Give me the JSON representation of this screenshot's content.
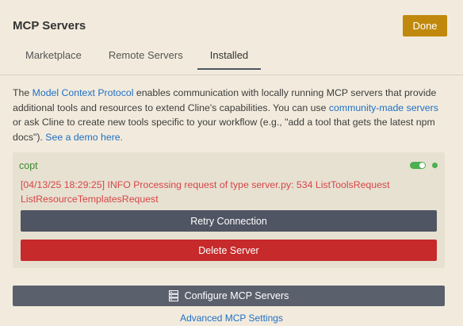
{
  "header": {
    "title": "MCP Servers",
    "done_label": "Done"
  },
  "tabs": [
    {
      "label": "Marketplace",
      "active": false
    },
    {
      "label": "Remote Servers",
      "active": false
    },
    {
      "label": "Installed",
      "active": true
    }
  ],
  "intro": {
    "text_1": "The ",
    "link_protocol": "Model Context Protocol",
    "text_2": " enables communication with locally running MCP servers that provide additional tools and resources to extend Cline's capabilities. You can use ",
    "link_community": "community-made servers",
    "text_3": " or ask Cline to create new tools specific to your workflow (e.g., \"add a tool that gets the latest npm docs\"). ",
    "link_demo": "See a demo here.",
    "text_4": ""
  },
  "server": {
    "name": "copt",
    "enabled": true,
    "status_color": "#4caf50",
    "error": "[04/13/25 18:29:25] INFO Processing request of type server.py: 534 ListToolsRequest ListResourceTemplatesRequest",
    "retry_label": "Retry Connection",
    "delete_label": "Delete Server"
  },
  "footer": {
    "configure_label": "Configure MCP Servers",
    "configure_icon": "server-icon",
    "advanced_label": "Advanced MCP Settings"
  },
  "colors": {
    "background": "#f2ebdd",
    "accent": "#c0890d",
    "link": "#1f6fc5",
    "error": "#d64545",
    "danger": "#c62a2a",
    "success": "#4caf50"
  }
}
